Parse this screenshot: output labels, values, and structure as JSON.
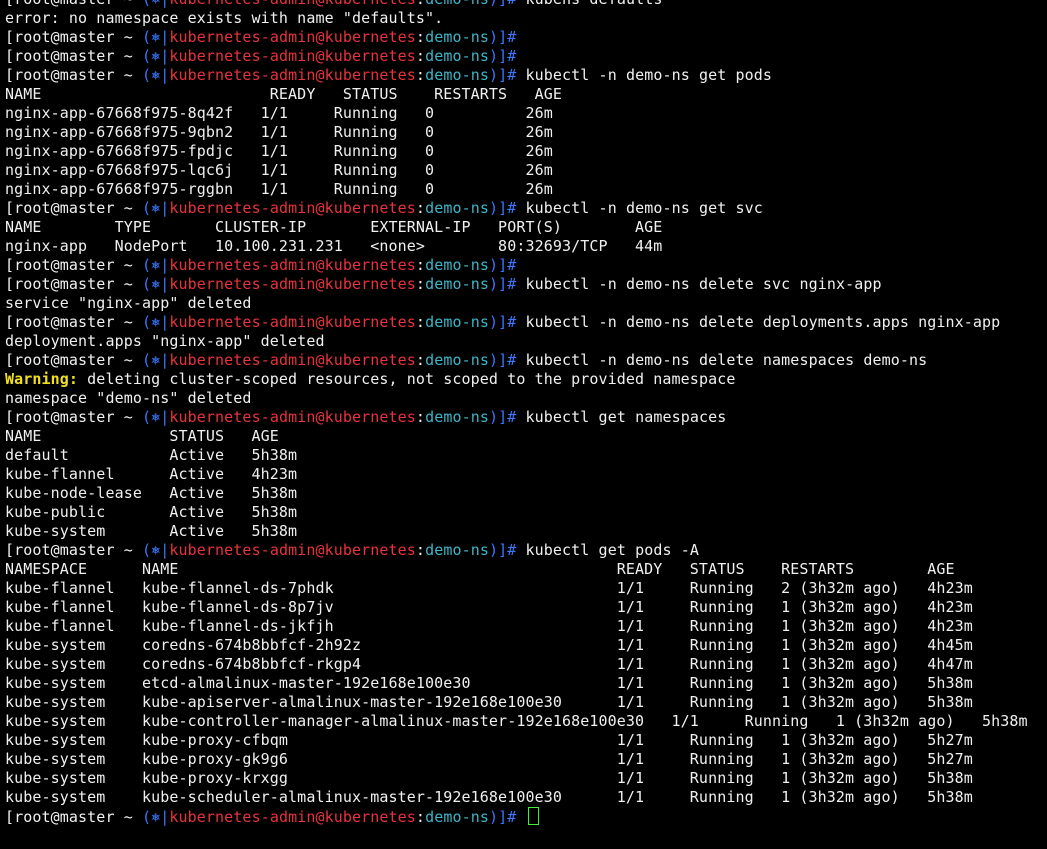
{
  "terminal": {
    "prompt": {
      "user": "[root@master ~ ",
      "open": "(",
      "glyph": "⎈",
      "bar": "|",
      "cluster": "kubernetes-admin@kubernetes",
      "colon": ":",
      "namespace": "demo-ns",
      "close": ")]# "
    },
    "colors": {
      "background": "#000000",
      "text": "#f0f0f0",
      "paren": "#3a78ff",
      "cluster": "#e8323c",
      "namespace": "#3bb6c9",
      "warning": "#f0e020",
      "cursor": "#3ef03e"
    },
    "lines": [
      {
        "type": "prompt",
        "cmd": "kubens defaults"
      },
      {
        "type": "out",
        "text": "error: no namespace exists with name \"defaults\"."
      },
      {
        "type": "prompt",
        "cmd": ""
      },
      {
        "type": "prompt",
        "cmd": ""
      },
      {
        "type": "prompt",
        "cmd": "kubectl -n demo-ns get pods"
      },
      {
        "type": "out",
        "text": "NAME                         READY   STATUS    RESTARTS   AGE"
      },
      {
        "type": "out",
        "text": "nginx-app-67668f975-8q42f   1/1     Running   0          26m"
      },
      {
        "type": "out",
        "text": "nginx-app-67668f975-9qbn2   1/1     Running   0          26m"
      },
      {
        "type": "out",
        "text": "nginx-app-67668f975-fpdjc   1/1     Running   0          26m"
      },
      {
        "type": "out",
        "text": "nginx-app-67668f975-lqc6j   1/1     Running   0          26m"
      },
      {
        "type": "out",
        "text": "nginx-app-67668f975-rggbn   1/1     Running   0          26m"
      },
      {
        "type": "prompt",
        "cmd": "kubectl -n demo-ns get svc"
      },
      {
        "type": "out",
        "text": "NAME        TYPE       CLUSTER-IP       EXTERNAL-IP   PORT(S)        AGE"
      },
      {
        "type": "out",
        "text": "nginx-app   NodePort   10.100.231.231   <none>        80:32693/TCP   44m"
      },
      {
        "type": "prompt",
        "cmd": ""
      },
      {
        "type": "prompt",
        "cmd": "kubectl -n demo-ns delete svc nginx-app"
      },
      {
        "type": "out",
        "text": "service \"nginx-app\" deleted"
      },
      {
        "type": "prompt",
        "cmd": "kubectl -n demo-ns delete deployments.apps nginx-app"
      },
      {
        "type": "out",
        "text": "deployment.apps \"nginx-app\" deleted"
      },
      {
        "type": "prompt",
        "cmd": "kubectl -n demo-ns delete namespaces demo-ns"
      },
      {
        "type": "warn",
        "label": "Warning:",
        "text": " deleting cluster-scoped resources, not scoped to the provided namespace"
      },
      {
        "type": "out",
        "text": "namespace \"demo-ns\" deleted"
      },
      {
        "type": "prompt",
        "cmd": "kubectl get namespaces"
      },
      {
        "type": "out",
        "text": "NAME              STATUS   AGE"
      },
      {
        "type": "out",
        "text": "default           Active   5h38m"
      },
      {
        "type": "out",
        "text": "kube-flannel      Active   4h23m"
      },
      {
        "type": "out",
        "text": "kube-node-lease   Active   5h38m"
      },
      {
        "type": "out",
        "text": "kube-public       Active   5h38m"
      },
      {
        "type": "out",
        "text": "kube-system       Active   5h38m"
      },
      {
        "type": "prompt",
        "cmd": "kubectl get pods -A"
      },
      {
        "type": "out",
        "text": "NAMESPACE      NAME                                                READY   STATUS    RESTARTS        AGE"
      },
      {
        "type": "out",
        "text": "kube-flannel   kube-flannel-ds-7phdk                               1/1     Running   2 (3h32m ago)   4h23m"
      },
      {
        "type": "out",
        "text": "kube-flannel   kube-flannel-ds-8p7jv                               1/1     Running   1 (3h32m ago)   4h23m"
      },
      {
        "type": "out",
        "text": "kube-flannel   kube-flannel-ds-jkfjh                               1/1     Running   1 (3h32m ago)   4h23m"
      },
      {
        "type": "out",
        "text": "kube-system    coredns-674b8bbfcf-2h92z                            1/1     Running   1 (3h32m ago)   4h45m"
      },
      {
        "type": "out",
        "text": "kube-system    coredns-674b8bbfcf-rkgp4                            1/1     Running   1 (3h32m ago)   4h47m"
      },
      {
        "type": "out",
        "text": "kube-system    etcd-almalinux-master-192e168e100e30                1/1     Running   1 (3h32m ago)   5h38m"
      },
      {
        "type": "out",
        "text": "kube-system    kube-apiserver-almalinux-master-192e168e100e30      1/1     Running   1 (3h32m ago)   5h38m"
      },
      {
        "type": "out",
        "text": "kube-system    kube-controller-manager-almalinux-master-192e168e100e30   1/1     Running   1 (3h32m ago)   5h38m"
      },
      {
        "type": "out",
        "text": "kube-system    kube-proxy-cfbqm                                    1/1     Running   1 (3h32m ago)   5h27m"
      },
      {
        "type": "out",
        "text": "kube-system    kube-proxy-gk9g6                                    1/1     Running   1 (3h32m ago)   5h27m"
      },
      {
        "type": "out",
        "text": "kube-system    kube-proxy-krxgg                                    1/1     Running   1 (3h32m ago)   5h38m"
      },
      {
        "type": "out",
        "text": "kube-system    kube-scheduler-almalinux-master-192e168e100e30      1/1     Running   1 (3h32m ago)   5h38m"
      },
      {
        "type": "prompt",
        "cmd": "",
        "cursor": true
      }
    ]
  }
}
